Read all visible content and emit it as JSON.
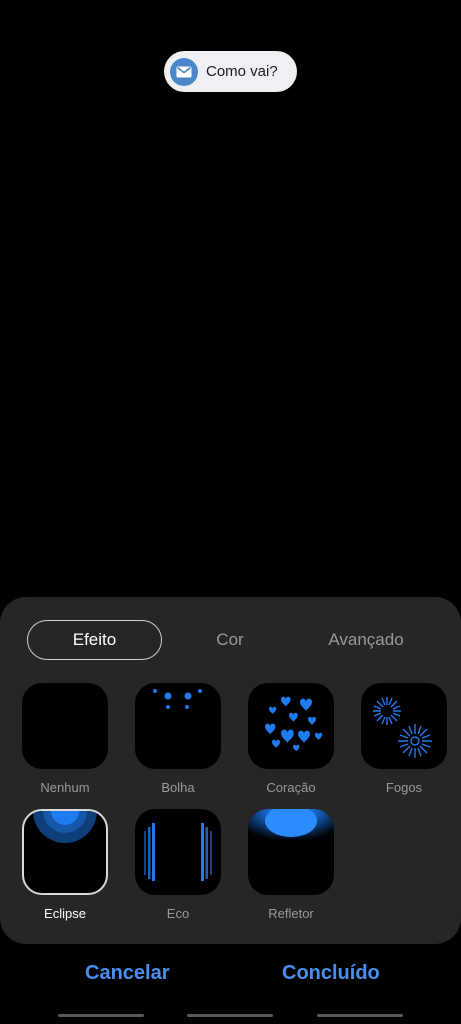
{
  "notification": {
    "text": "Como vai?",
    "icon": "envelope-icon"
  },
  "tabs": [
    {
      "label": "Efeito",
      "active": true
    },
    {
      "label": "Cor",
      "active": false
    },
    {
      "label": "Avançado",
      "active": false
    }
  ],
  "effects": [
    {
      "label": "Nenhum",
      "selected": false
    },
    {
      "label": "Bolha",
      "selected": false
    },
    {
      "label": "Coração",
      "selected": false
    },
    {
      "label": "Fogos",
      "selected": false
    },
    {
      "label": "Eclipse",
      "selected": true
    },
    {
      "label": "Eco",
      "selected": false
    },
    {
      "label": "Refletor",
      "selected": false
    }
  ],
  "actions": {
    "cancel": "Cancelar",
    "done": "Concluído"
  },
  "colors": {
    "accent": "#4a8ff0",
    "effect_blue": "#1e7bf0",
    "panel": "#262626"
  }
}
